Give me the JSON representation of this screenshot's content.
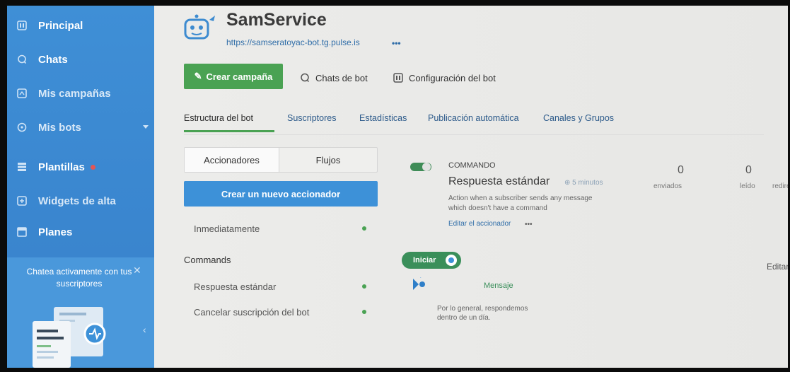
{
  "sidebar": {
    "items": [
      {
        "label": "Principal",
        "icon": "home-square-icon"
      },
      {
        "label": "Chats",
        "icon": "chat-bubble-icon"
      },
      {
        "label": "Mis campañas",
        "icon": "campaign-icon"
      },
      {
        "label": "Mis bots",
        "icon": "bot-icon"
      },
      {
        "label": "Plantillas",
        "icon": "template-icon"
      },
      {
        "label": "Widgets de alta",
        "icon": "widget-icon"
      },
      {
        "label": "Planes",
        "icon": "plans-icon"
      }
    ],
    "promo": {
      "text": "Chatea activamente con tus suscriptores"
    }
  },
  "bot": {
    "name": "SamService",
    "url": "https://samseratoyac-bot.tg.pulse.is",
    "more": "•••"
  },
  "actions": {
    "create_campaign": "Crear campaña",
    "bot_chats": "Chats de bot",
    "bot_config": "Configuración del bot"
  },
  "tabs": [
    "Estructura del bot",
    "Suscriptores",
    "Estadísticas",
    "Publicación automática",
    "Canales y Grupos"
  ],
  "panel": {
    "segment_a": "Accionadores",
    "segment_b": "Flujos",
    "create_trigger": "Crear un nuevo accionador",
    "immediate": "Inmediatamente",
    "commands_title": "Commands",
    "commands": [
      "Respuesta estándar",
      "Cancelar suscripción del bot"
    ]
  },
  "command_card": {
    "type": "COMMANDO",
    "title": "Respuesta estándar",
    "time": "5 minutos",
    "desc_line1": "Action when a subscriber sends any message",
    "desc_line2": "which doesn't have a command",
    "edit_link": "Editar el accionador",
    "edit_more": "•••"
  },
  "stats": [
    {
      "value": "0",
      "label": "enviados"
    },
    {
      "value": "0",
      "label": "leído"
    },
    {
      "value": "",
      "label": "redire"
    }
  ],
  "flow": {
    "start_pill": "Iniciar",
    "message_label": "Mensaje",
    "note_line1": "Por lo general, respondemos",
    "note_line2": "dentro de un día.",
    "edit_right": "Editar e"
  },
  "colors": {
    "sidebar": "#3f8fd6",
    "green": "#4aa253",
    "blue_button": "#3d91d8",
    "link": "#2f6da8"
  }
}
